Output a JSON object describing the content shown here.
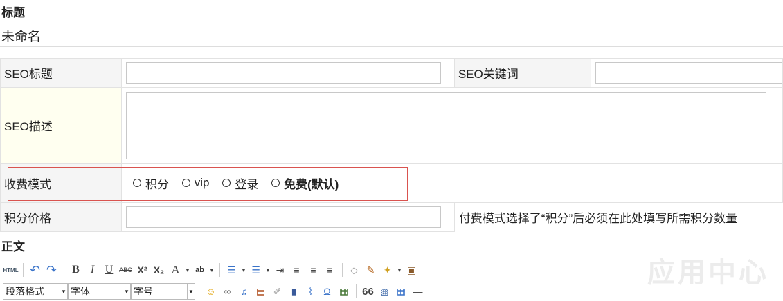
{
  "header": {
    "title_section": "标题",
    "title_value": "未命名"
  },
  "form": {
    "seo_title_label": "SEO标题",
    "seo_keywords_label": "SEO关键词",
    "seo_desc_label": "SEO描述",
    "charge_mode_label": "收费模式",
    "charge_options": [
      "积分",
      "vip",
      "登录",
      "免费(默认)"
    ],
    "points_price_label": "积分价格",
    "points_hint": "付费模式选择了“积分”后必须在此处填写所需积分数量"
  },
  "body_section": "正文",
  "toolbar": {
    "html_label": "HTML",
    "bold": "B",
    "italic": "I",
    "underline": "U",
    "strike": "ABC",
    "sup": "X²",
    "sub": "X₂",
    "font_color": "A",
    "highlight": "ab",
    "quote": "66",
    "paragraph_select": "段落格式",
    "font_select": "字体",
    "size_select": "字号",
    "omega": "Ω"
  },
  "watermark": "应用中心"
}
